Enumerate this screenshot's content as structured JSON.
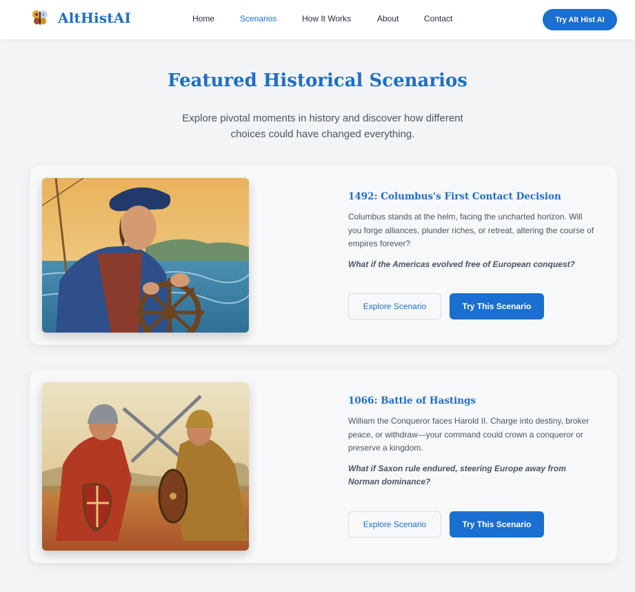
{
  "brand": {
    "name": "AltHistAI",
    "logo_icon": "butterfly-icon"
  },
  "nav": {
    "items": [
      {
        "label": "Home",
        "active": false
      },
      {
        "label": "Scenarios",
        "active": true
      },
      {
        "label": "How It Works",
        "active": false
      },
      {
        "label": "About",
        "active": false
      },
      {
        "label": "Contact",
        "active": false
      }
    ],
    "cta_label": "Try Alt Hist AI"
  },
  "hero": {
    "title": "Featured Historical Scenarios",
    "subtitle": "Explore pivotal moments in history and discover how different choices could have changed everything."
  },
  "scenarios": [
    {
      "title": "1492: Columbus's First Contact Decision",
      "description": "Columbus stands at the helm, facing the uncharted horizon. Will you forge alliances, plunder riches, or retreat, altering the course of empires forever?",
      "question": "What if the Americas evolved free of European conquest?",
      "explore_label": "Explore Scenario",
      "try_label": "Try This Scenario",
      "image_icon": "columbus-painting"
    },
    {
      "title": "1066: Battle of Hastings",
      "description": "William the Conqueror faces Harold II. Charge into destiny, broker peace, or withdraw—your command could crown a conqueror or preserve a kingdom.",
      "question": "What if Saxon rule endured, steering Europe away from Norman dominance?",
      "explore_label": "Explore Scenario",
      "try_label": "Try This Scenario",
      "image_icon": "hastings-painting"
    }
  ],
  "colors": {
    "accent": "#1d6ec9",
    "button": "#1a6fd0",
    "background": "#f3f4f6"
  }
}
